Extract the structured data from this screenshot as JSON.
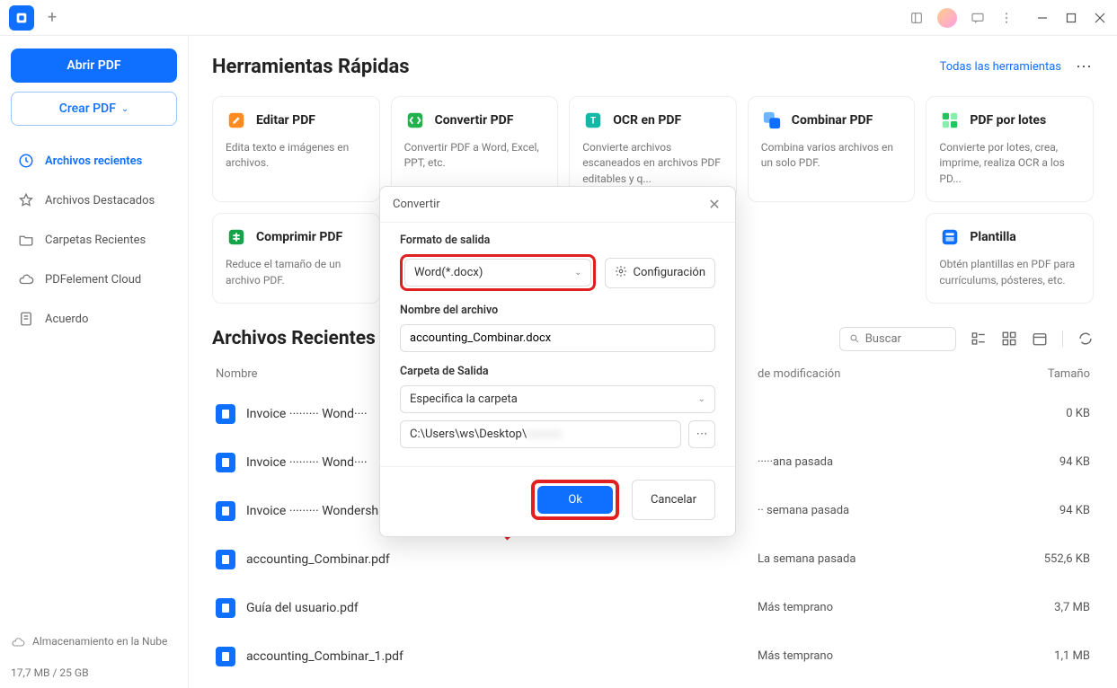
{
  "sidebar": {
    "open_btn": "Abrir PDF",
    "create_btn": "Crear PDF",
    "items": [
      {
        "label": "Archivos recientes"
      },
      {
        "label": "Archivos Destacados"
      },
      {
        "label": "Carpetas Recientes"
      },
      {
        "label": "PDFelement Cloud"
      },
      {
        "label": "Acuerdo"
      }
    ],
    "storage_label": "Almacenamiento en la Nube",
    "storage_usage": "17,7 MB / 25 GB"
  },
  "quick_tools": {
    "title": "Herramientas Rápidas",
    "all_link": "Todas las herramientas",
    "cards": [
      {
        "title": "Editar PDF",
        "desc": "Edita texto e imágenes en archivos.",
        "color": "#ff8a1f"
      },
      {
        "title": "Convertir PDF",
        "desc": "Convertir PDF a Word, Excel, PPT, etc.",
        "color": "#22b14c"
      },
      {
        "title": "OCR en PDF",
        "desc": "Convierte archivos escaneados en archivos PDF editables y q...",
        "color": "#14b8a6"
      },
      {
        "title": "Combinar PDF",
        "desc": "Combina varios archivos en un solo PDF.",
        "color": "#0f6fff"
      },
      {
        "title": "PDF por lotes",
        "desc": "Convierte por lotes, crea, imprime, realiza OCR a los PD...",
        "color": "#22c55e"
      },
      {
        "title": "Comprimir PDF",
        "desc": "Reduce el tamaño de un archivo PDF.",
        "color": "#16a34a"
      },
      {
        "title": "",
        "desc": "",
        "color": ""
      },
      {
        "title": "",
        "desc": "",
        "color": ""
      },
      {
        "title": "",
        "desc": "",
        "color": ""
      },
      {
        "title": "Plantilla",
        "desc": "Obtén plantillas en PDF para currículums, pósteres, etc.",
        "color": "#0f6fff"
      }
    ]
  },
  "recent": {
    "title": "Archivos Recientes",
    "search_placeholder": "Buscar",
    "cols": {
      "name": "Nombre",
      "date": "de modificación",
      "size": "Tamaño"
    },
    "rows": [
      {
        "name": "Invoice ········· Wond····",
        "date": "",
        "size": "0 KB"
      },
      {
        "name": "Invoice ········· Wond····",
        "date": "·····ana pasada",
        "size": "94 KB"
      },
      {
        "name": "Invoice ········· Wondershare PDF ·· ··· ···· (·).p··",
        "date": "·· semana pasada",
        "size": "94 KB"
      },
      {
        "name": "accounting_Combinar.pdf",
        "date": "La semana pasada",
        "size": "552,6 KB"
      },
      {
        "name": "Guía del usuario.pdf",
        "date": "Más temprano",
        "size": "3,7 MB"
      },
      {
        "name": "accounting_Combinar_1.pdf",
        "date": "Más temprano",
        "size": "1,1 MB"
      }
    ]
  },
  "dialog": {
    "title": "Convertir",
    "format_label": "Formato de salida",
    "format_value": "Word(*.docx)",
    "config_btn": "Configuración",
    "filename_label": "Nombre del archivo",
    "filename_value": "accounting_Combinar.docx",
    "folder_label": "Carpeta de Salida",
    "folder_select": "Especifica la carpeta",
    "folder_path": "C:\\Users\\ws\\Desktop\\",
    "ok": "Ok",
    "cancel": "Cancelar"
  }
}
